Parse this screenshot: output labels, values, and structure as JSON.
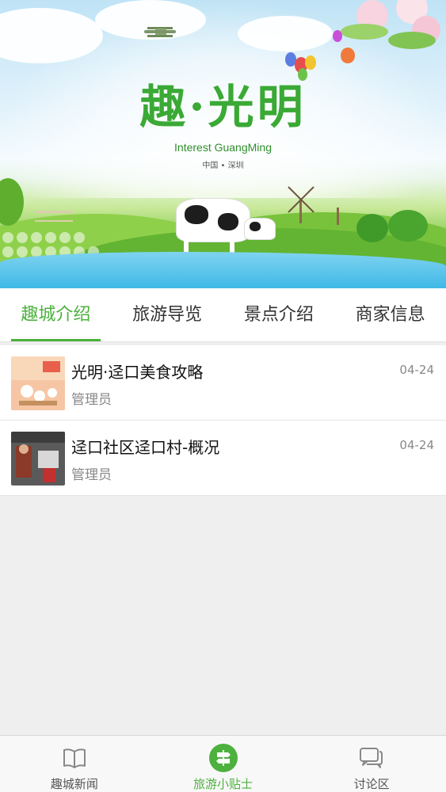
{
  "banner": {
    "title": "趣·光明",
    "subtitle": "Interest GuangMing",
    "place": "中国 • 深圳"
  },
  "tabs": [
    {
      "label": "趣城介绍",
      "active": true
    },
    {
      "label": "旅游导览",
      "active": false
    },
    {
      "label": "景点介绍",
      "active": false
    },
    {
      "label": "商家信息",
      "active": false
    }
  ],
  "articles": [
    {
      "title": "光明·迳口美食攻略",
      "author": "管理员",
      "date": "04-24"
    },
    {
      "title": "迳口社区迳口村-概况",
      "author": "管理员",
      "date": "04-24"
    }
  ],
  "bottom_nav": [
    {
      "label": "趣城新闻",
      "icon": "book-icon",
      "active": false
    },
    {
      "label": "旅游小贴士",
      "icon": "signpost-icon",
      "active": true
    },
    {
      "label": "讨论区",
      "icon": "chat-bubbles-icon",
      "active": false
    }
  ],
  "colors": {
    "accent": "#4cb13d",
    "text": "#333333",
    "muted": "#888888",
    "background": "#efefef"
  }
}
